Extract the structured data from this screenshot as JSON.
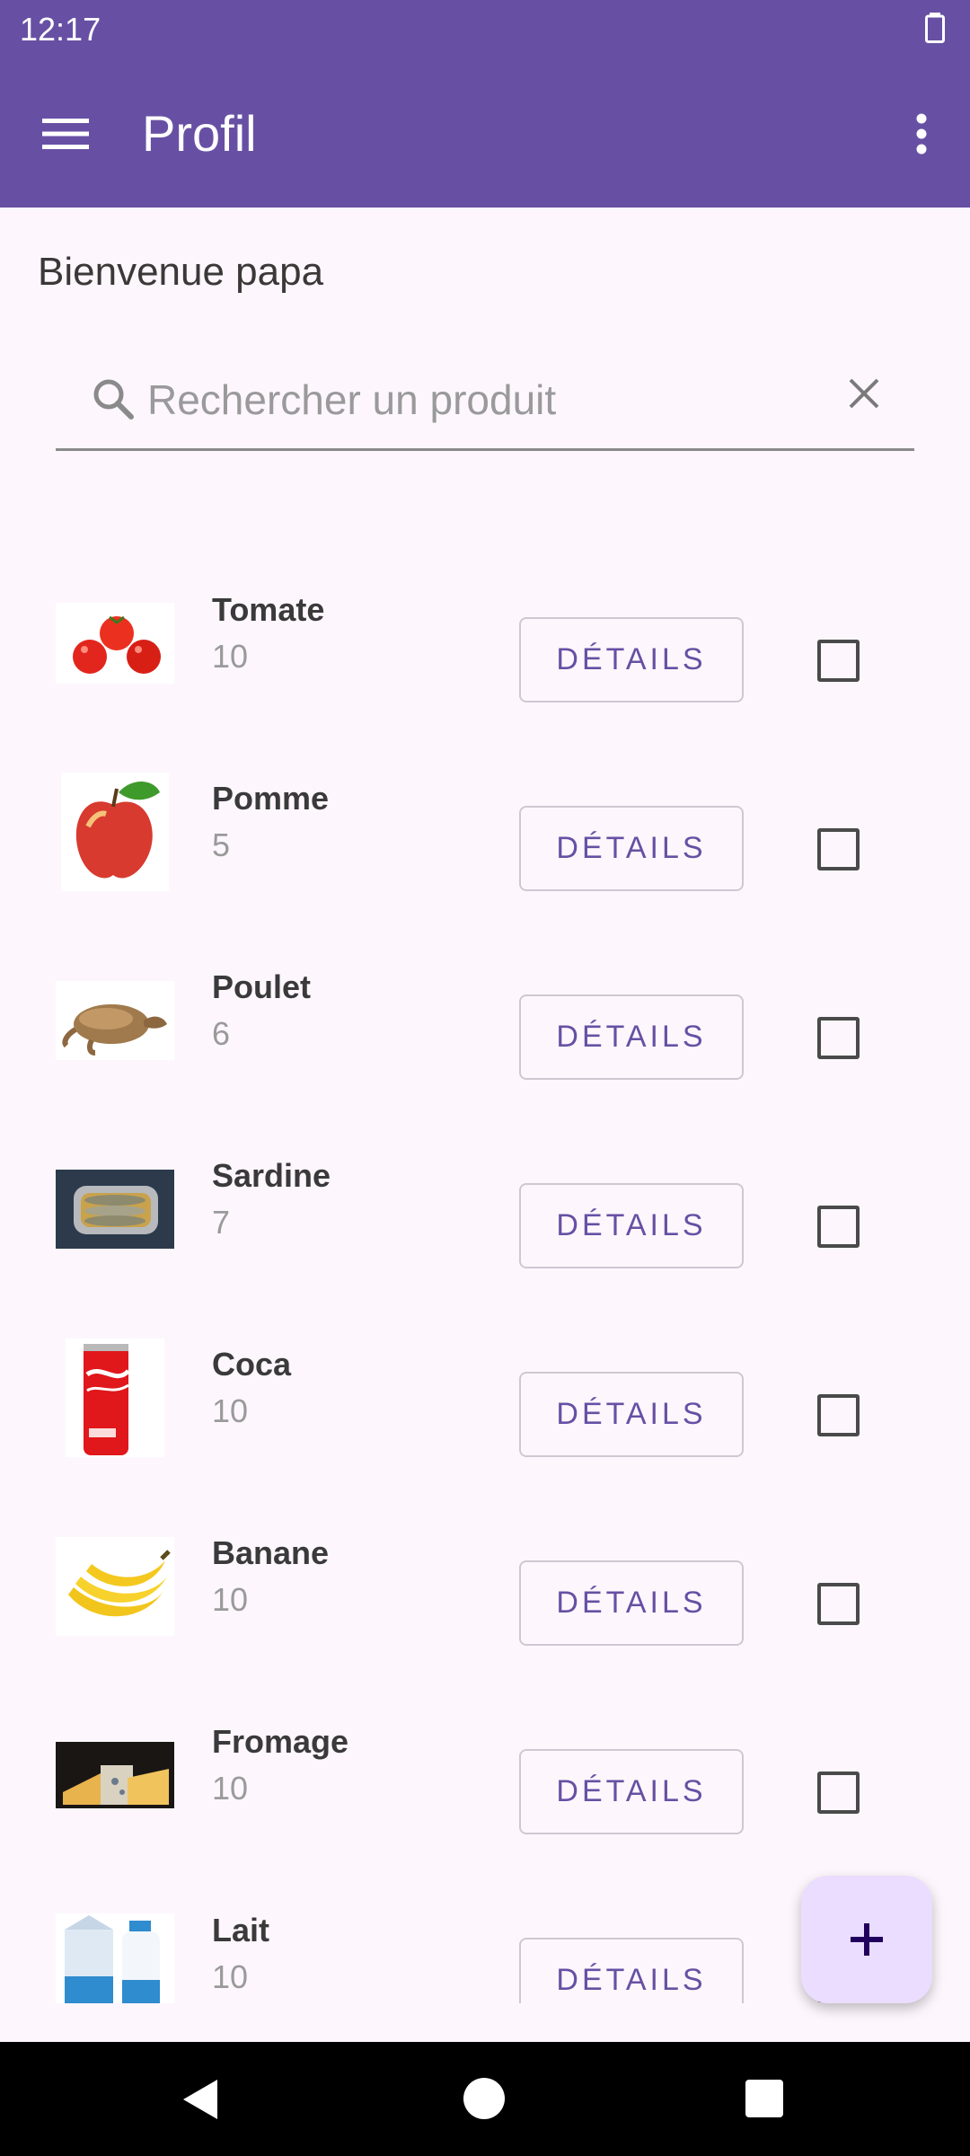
{
  "status_bar": {
    "time": "12:17"
  },
  "app_bar": {
    "title": "Profil",
    "menu_icon": "hamburger-menu-icon",
    "overflow_icon": "more-vert-icon"
  },
  "welcome": "Bienvenue papa",
  "search": {
    "placeholder": "Rechercher un produit",
    "value": ""
  },
  "colors": {
    "primary": "#6750a4",
    "fab_bg": "#eaddff",
    "background": "#fdf7fd"
  },
  "products": [
    {
      "name": "Tomate",
      "qty": "10",
      "button": "DÉTAILS",
      "icon": "tomato-image",
      "checked": false
    },
    {
      "name": "Pomme",
      "qty": "5",
      "button": "DÉTAILS",
      "icon": "apple-image",
      "checked": false
    },
    {
      "name": "Poulet",
      "qty": "6",
      "button": "DÉTAILS",
      "icon": "chicken-image",
      "checked": false
    },
    {
      "name": "Sardine",
      "qty": "7",
      "button": "DÉTAILS",
      "icon": "sardine-can-image",
      "checked": false
    },
    {
      "name": "Coca",
      "qty": "10",
      "button": "DÉTAILS",
      "icon": "coca-can-image",
      "checked": false
    },
    {
      "name": "Banane",
      "qty": "10",
      "button": "DÉTAILS",
      "icon": "banana-image",
      "checked": false
    },
    {
      "name": "Fromage",
      "qty": "10",
      "button": "DÉTAILS",
      "icon": "cheese-image",
      "checked": false
    },
    {
      "name": "Lait",
      "qty": "10",
      "button": "DÉTAILS",
      "icon": "milk-image",
      "checked": false
    }
  ],
  "fab": {
    "icon": "plus-icon"
  }
}
